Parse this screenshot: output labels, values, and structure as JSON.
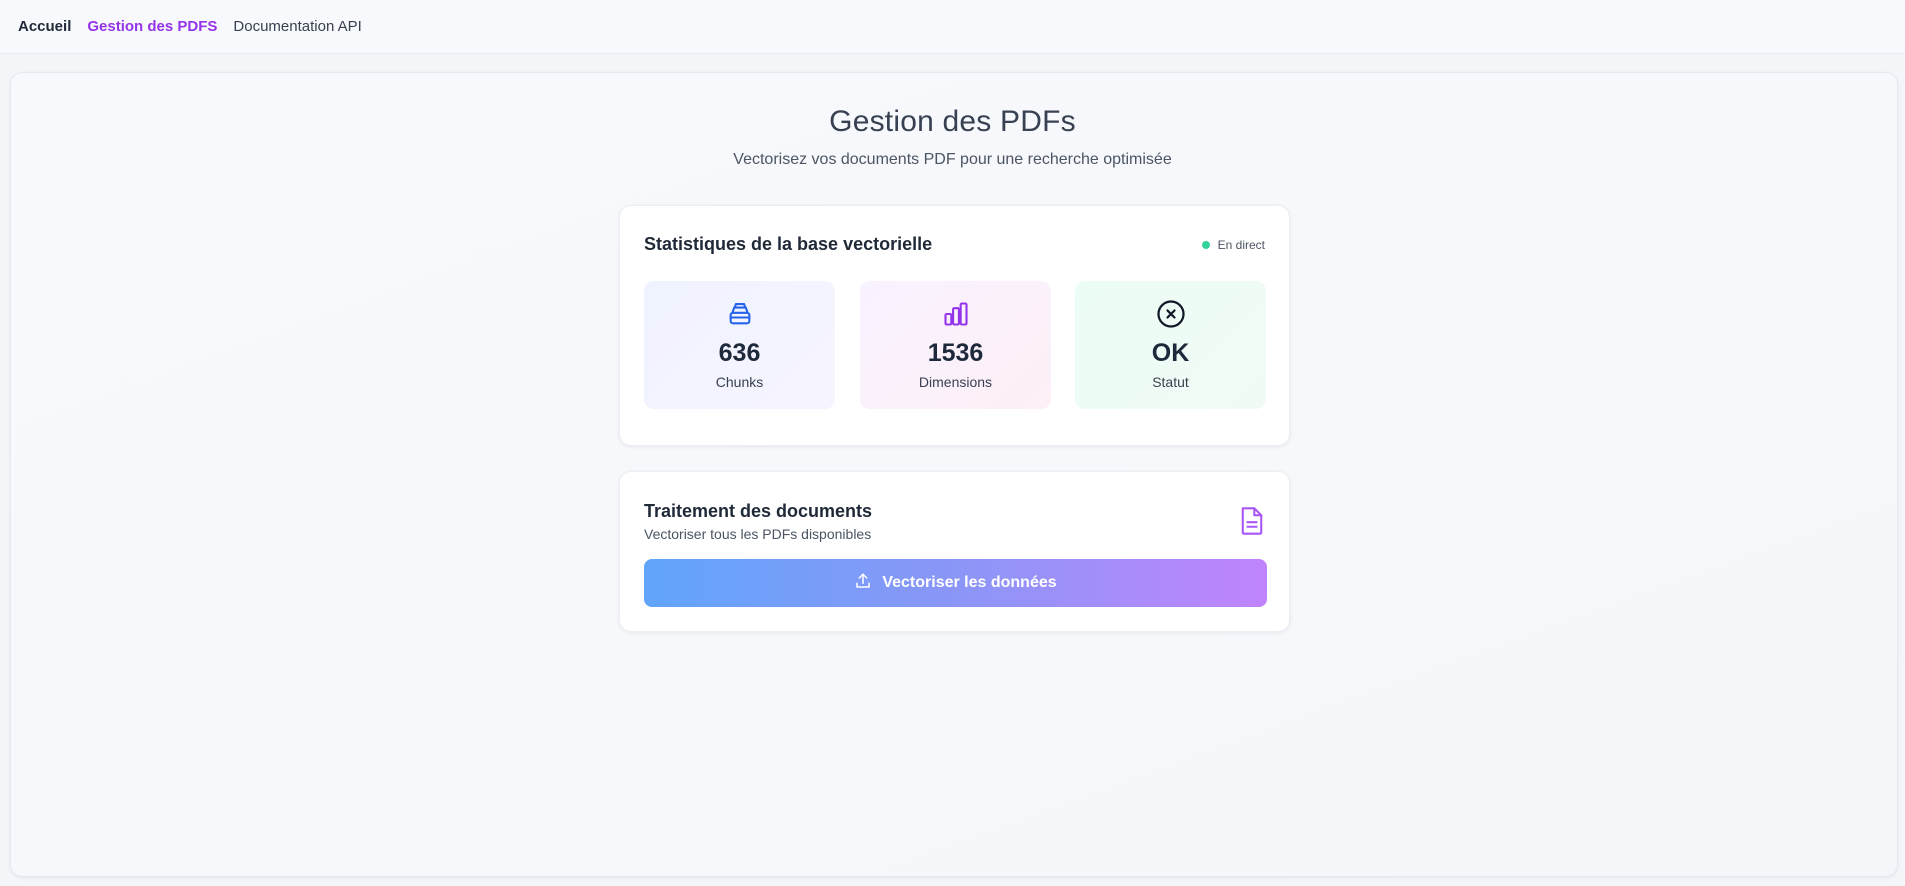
{
  "nav": {
    "home": "Accueil",
    "pdf_management": "Gestion des PDFS",
    "api_docs": "Documentation API"
  },
  "header": {
    "title": "Gestion des PDFs",
    "subtitle": "Vectorisez vos documents PDF pour une recherche optimisée"
  },
  "stats": {
    "title": "Statistiques de la base vectorielle",
    "live_label": "En direct",
    "tiles": [
      {
        "value": "636",
        "label": "Chunks",
        "icon": "database-icon",
        "color": "#2563eb"
      },
      {
        "value": "1536",
        "label": "Dimensions",
        "icon": "bar-chart-icon",
        "color": "#9333ea"
      },
      {
        "value": "OK",
        "label": "Statut",
        "icon": "close-circle-icon",
        "color": "#111827"
      }
    ]
  },
  "processing": {
    "title": "Traitement des documents",
    "description": "Vectoriser tous les PDFs disponibles",
    "button_label": "Vectoriser les données",
    "icon": "document-icon",
    "icon_color": "#a855f7"
  },
  "colors": {
    "accent": "#9333ea",
    "live": "#34d399",
    "button_start": "#60a5fa",
    "button_end": "#c084fc"
  }
}
